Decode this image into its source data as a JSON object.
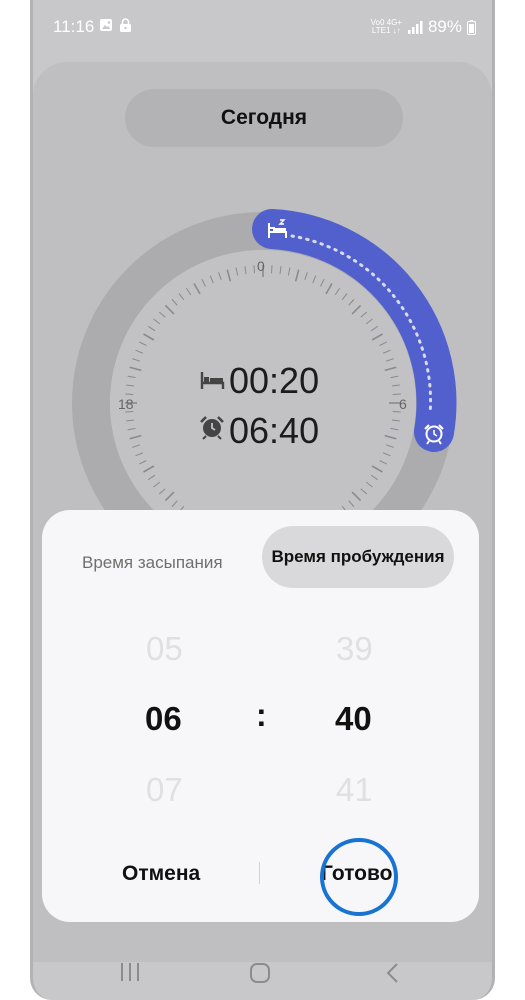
{
  "status": {
    "time": "11:16",
    "network_top": "Vo0 4G+",
    "network_bottom": "LTE1 ↓↑",
    "battery": "89%"
  },
  "header": {
    "date_button": "Сегодня"
  },
  "dial": {
    "tick_0": "0",
    "tick_6": "6",
    "tick_18": "18",
    "bedtime": "00:20",
    "wake": "06:40"
  },
  "sheet": {
    "tab_bedtime": "Время засыпания",
    "tab_wake": "Время пробуждения",
    "hours": {
      "prev": "05",
      "selected": "06",
      "next": "07"
    },
    "separator": ":",
    "minutes": {
      "prev": "39",
      "selected": "40",
      "next": "41"
    },
    "cancel": "Отмена",
    "done": "Готово"
  },
  "colors": {
    "accent": "#5160cc",
    "highlight_ring": "#1873d3"
  }
}
